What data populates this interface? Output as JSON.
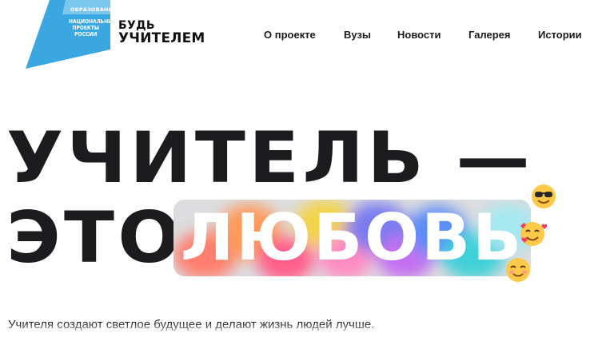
{
  "logo": {
    "top_text": "ОБРАЗОВАНИЕ",
    "main_text_line1": "НАЦИОНАЛЬНЫЕ",
    "main_text_line2": "ПРОЕКТЫ",
    "main_text_line3": "РОССИИ",
    "color": "#3aa7e0"
  },
  "brand": {
    "line1": "БУДЬ",
    "line2": "УЧИТЕЛЕМ"
  },
  "nav": {
    "items": [
      {
        "label": "О проекте"
      },
      {
        "label": "Вузы"
      },
      {
        "label": "Новости"
      },
      {
        "label": "Галерея"
      },
      {
        "label": "Истории"
      }
    ]
  },
  "hero": {
    "line1": "УЧИТЕЛЬ —",
    "line2_prefix": "ЭТО",
    "highlight": "ЛЮБОВЬ",
    "emojis": [
      "smiling-face-with-sunglasses",
      "smiling-face-with-hearts",
      "smiling-face-with-smiling-eyes"
    ]
  },
  "subtitle": "Учителя создают светлое будущее и делают жизнь людей лучше."
}
